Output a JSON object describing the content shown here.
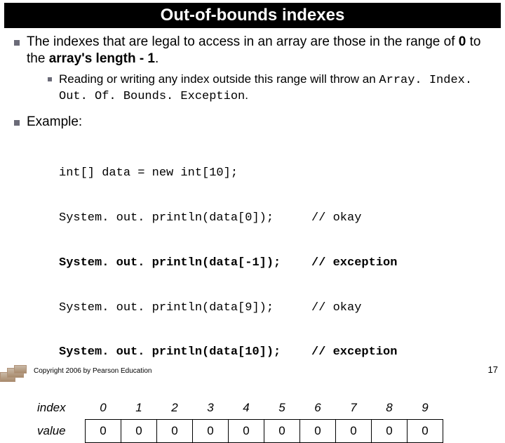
{
  "title": "Out-of-bounds indexes",
  "bullet1_pre": "The indexes that are legal to access in an array are those in the range of ",
  "bullet1_b1": "0",
  "bullet1_mid": " to the ",
  "bullet1_b2": "array's length - 1",
  "bullet1_post": ".",
  "bullet2_pre": "Reading or writing any index outside this range will throw an ",
  "bullet2_code": "Array. Index. Out. Of. Bounds. Exception",
  "bullet2_post": ".",
  "bullet3": "Example:",
  "code": {
    "l0": "int[] data = new int[10];",
    "l1": "System. out. println(data[0]);",
    "l2": "System. out. println(data[-1]);",
    "l3": "System. out. println(data[9]);",
    "l4": "System. out. println(data[10]);",
    "c1": "// okay",
    "c2": "// exception",
    "c3": "// okay",
    "c4": "// exception"
  },
  "array": {
    "index_label": "index",
    "value_label": "value",
    "idx": [
      "0",
      "1",
      "2",
      "3",
      "4",
      "5",
      "6",
      "7",
      "8",
      "9"
    ],
    "val": [
      "0",
      "0",
      "0",
      "0",
      "0",
      "0",
      "0",
      "0",
      "0",
      "0"
    ]
  },
  "footer": "Copyright 2006 by Pearson Education",
  "page": "17"
}
